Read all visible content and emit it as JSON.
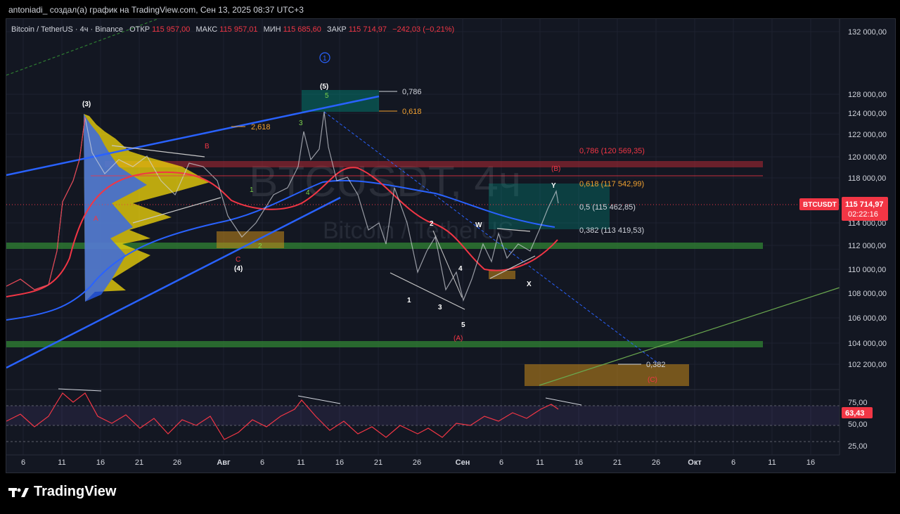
{
  "header": {
    "text": "antoniadi_ создал(а) график на TradingView.com, Сен 13, 2025 08:37 UTC+3"
  },
  "legend": {
    "symbol": "Bitcoin / TetherUS · 4ч · Binance",
    "open_label": "ОТКР",
    "open": "115 957,00",
    "high_label": "МАКС",
    "high": "115 957,01",
    "low_label": "МИН",
    "low": "115 685,60",
    "close_label": "ЗАКР",
    "close": "115 714,97",
    "change": "−242,03 (−0,21%)"
  },
  "watermark": {
    "main": "BTCUSDT, 4ч",
    "sub": "Bitcoin / TetherUS"
  },
  "price_axis": {
    "ticks": [
      "132 000,00",
      "128 000,00",
      "124 000,00",
      "122 000,00",
      "120 000,00",
      "118 000,00",
      "114 000,00",
      "112 000,00",
      "110 000,00",
      "108 000,00",
      "106 000,00",
      "104 000,00",
      "102 200,00"
    ]
  },
  "price_label": {
    "symbol": "BTCUSDT",
    "price": "115 714,97",
    "countdown": "02:22:16"
  },
  "rsi": {
    "ticks": [
      "75,00",
      "50,00",
      "25,00"
    ],
    "value": "63,43"
  },
  "time_axis": {
    "ticks": [
      "6",
      "11",
      "16",
      "21",
      "26",
      "Авг",
      "6",
      "11",
      "16",
      "21",
      "26",
      "Сен",
      "6",
      "11",
      "16",
      "21",
      "26",
      "Окт",
      "6",
      "11",
      "16"
    ]
  },
  "fib": {
    "f0786_top": "0,786",
    "f0618_top": "0,618",
    "f2618": "2,618",
    "f0786": "0,786 (120 569,35)",
    "f0618": "0,618 (117 542,99)",
    "f05": "0,5 (115 462,85)",
    "f0382": "0,382 (113 419,53)",
    "f0382_low": "0,382"
  },
  "waves": {
    "w3": "(3)",
    "w4": "(4)",
    "w5": "(5)",
    "circle1": "1",
    "A": "A",
    "B": "B",
    "C": "C",
    "g1": "1",
    "g2": "2",
    "g3": "3",
    "g4": "4",
    "g5": "5",
    "s1": "1",
    "s2": "2",
    "s3": "3",
    "s4": "4",
    "s5": "5",
    "WA": "(A)",
    "WB": "(B)",
    "WC": "(C)",
    "W": "W",
    "X": "X",
    "Y": "Y"
  },
  "footer": {
    "brand": "TradingView"
  },
  "colors": {
    "bg": "#131722",
    "red": "#f23645",
    "green": "#2e7d32",
    "blue": "#2962ff",
    "yellow": "#f5d90a",
    "orange": "#c98a1a"
  }
}
